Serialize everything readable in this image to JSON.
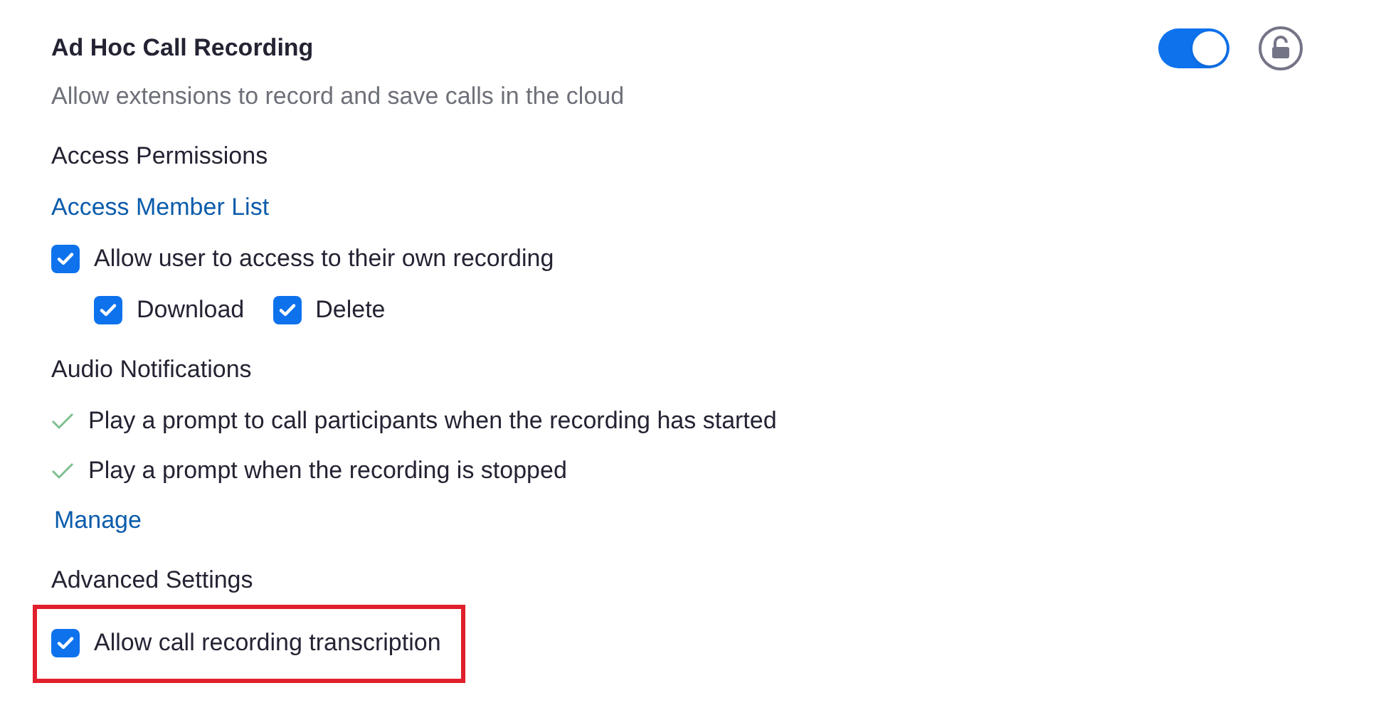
{
  "setting": {
    "title": "Ad Hoc Call Recording",
    "description": "Allow extensions to record and save calls in the cloud",
    "enabled": true,
    "locked": false
  },
  "rows": [
    {
      "kind": "heading",
      "text": "Access Permissions"
    },
    {
      "kind": "link",
      "text": "Access Member List"
    },
    {
      "kind": "checkbox",
      "label": "Allow user to access to their own recording",
      "checked": true,
      "highlighted": false
    },
    {
      "kind": "checkbox_group",
      "items": [
        {
          "label": "Download",
          "checked": true
        },
        {
          "label": "Delete",
          "checked": true
        }
      ]
    },
    {
      "kind": "heading",
      "text": "Audio Notifications"
    },
    {
      "kind": "check_item",
      "text": "Play a prompt to call participants when the recording has started"
    },
    {
      "kind": "check_item",
      "text": "Play a prompt when the recording is stopped"
    },
    {
      "kind": "link",
      "text": "Manage"
    },
    {
      "kind": "heading",
      "text": "Advanced Settings"
    },
    {
      "kind": "checkbox",
      "label": "Allow call recording transcription",
      "checked": true,
      "highlighted": true
    }
  ]
}
